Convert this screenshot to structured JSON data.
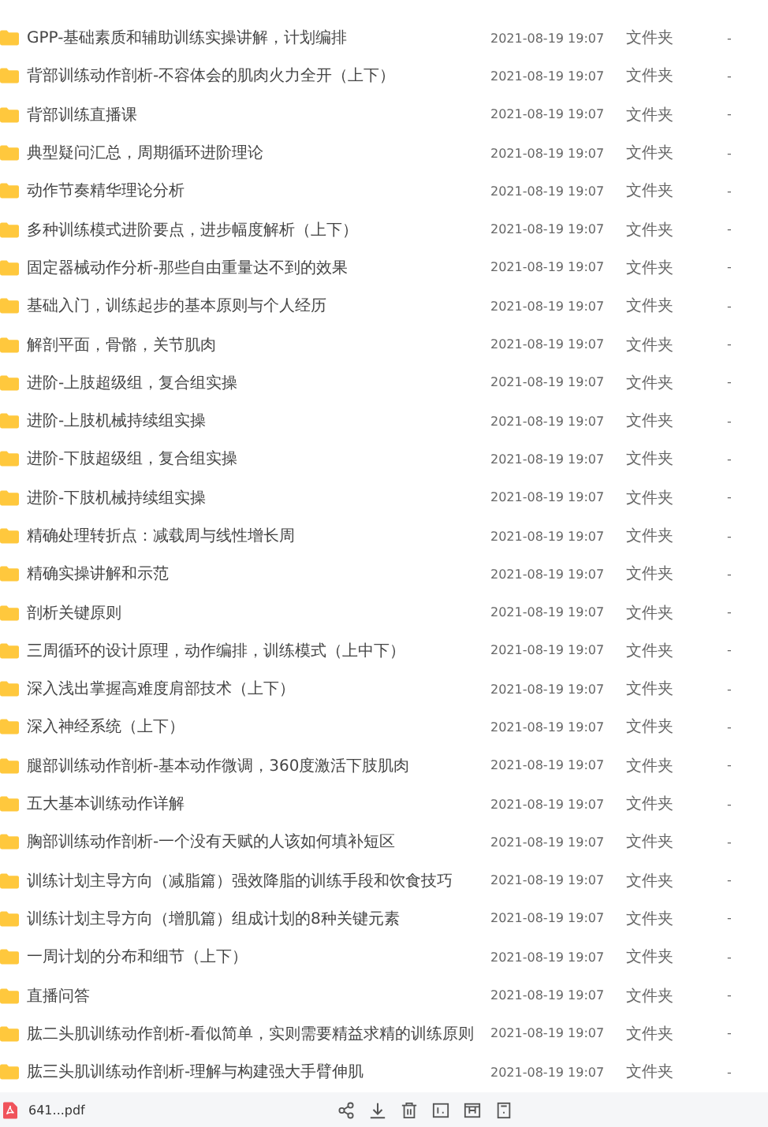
{
  "files": [
    {
      "name": "GPP-基础素质和辅助训练实操讲解，计划编排",
      "modified": "2021-08-19 19:07",
      "type": "文件夹",
      "size": "-"
    },
    {
      "name": "背部训练动作剖析-不容体会的肌肉火力全开（上下）",
      "modified": "2021-08-19 19:07",
      "type": "文件夹",
      "size": "-"
    },
    {
      "name": "背部训练直播课",
      "modified": "2021-08-19 19:07",
      "type": "文件夹",
      "size": "-"
    },
    {
      "name": "典型疑问汇总，周期循环进阶理论",
      "modified": "2021-08-19 19:07",
      "type": "文件夹",
      "size": "-"
    },
    {
      "name": "动作节奏精华理论分析",
      "modified": "2021-08-19 19:07",
      "type": "文件夹",
      "size": "-"
    },
    {
      "name": "多种训练模式进阶要点，进步幅度解析（上下）",
      "modified": "2021-08-19 19:07",
      "type": "文件夹",
      "size": "-"
    },
    {
      "name": "固定器械动作分析-那些自由重量达不到的效果",
      "modified": "2021-08-19 19:07",
      "type": "文件夹",
      "size": "-"
    },
    {
      "name": "基础入门，训练起步的基本原则与个人经历",
      "modified": "2021-08-19 19:07",
      "type": "文件夹",
      "size": "-"
    },
    {
      "name": "解剖平面，骨骼，关节肌肉",
      "modified": "2021-08-19 19:07",
      "type": "文件夹",
      "size": "-"
    },
    {
      "name": "进阶-上肢超级组，复合组实操",
      "modified": "2021-08-19 19:07",
      "type": "文件夹",
      "size": "-"
    },
    {
      "name": "进阶-上肢机械持续组实操",
      "modified": "2021-08-19 19:07",
      "type": "文件夹",
      "size": "-"
    },
    {
      "name": "进阶-下肢超级组，复合组实操",
      "modified": "2021-08-19 19:07",
      "type": "文件夹",
      "size": "-"
    },
    {
      "name": "进阶-下肢机械持续组实操",
      "modified": "2021-08-19 19:07",
      "type": "文件夹",
      "size": "-"
    },
    {
      "name": "精确处理转折点：减载周与线性增长周",
      "modified": "2021-08-19 19:07",
      "type": "文件夹",
      "size": "-"
    },
    {
      "name": "精确实操讲解和示范",
      "modified": "2021-08-19 19:07",
      "type": "文件夹",
      "size": "-"
    },
    {
      "name": "剖析关键原则",
      "modified": "2021-08-19 19:07",
      "type": "文件夹",
      "size": "-"
    },
    {
      "name": "三周循环的设计原理，动作编排，训练模式（上中下）",
      "modified": "2021-08-19 19:07",
      "type": "文件夹",
      "size": "-"
    },
    {
      "name": "深入浅出掌握高难度肩部技术（上下）",
      "modified": "2021-08-19 19:07",
      "type": "文件夹",
      "size": "-"
    },
    {
      "name": "深入神经系统（上下）",
      "modified": "2021-08-19 19:07",
      "type": "文件夹",
      "size": "-"
    },
    {
      "name": "腿部训练动作剖析-基本动作微调，360度激活下肢肌肉",
      "modified": "2021-08-19 19:07",
      "type": "文件夹",
      "size": "-"
    },
    {
      "name": "五大基本训练动作详解",
      "modified": "2021-08-19 19:07",
      "type": "文件夹",
      "size": "-"
    },
    {
      "name": "胸部训练动作剖析-一个没有天赋的人该如何填补短区",
      "modified": "2021-08-19 19:07",
      "type": "文件夹",
      "size": "-"
    },
    {
      "name": "训练计划主导方向（减脂篇）强效降脂的训练手段和饮食技巧",
      "modified": "2021-08-19 19:07",
      "type": "文件夹",
      "size": "-"
    },
    {
      "name": "训练计划主导方向（增肌篇）组成计划的8种关键元素",
      "modified": "2021-08-19 19:07",
      "type": "文件夹",
      "size": "-"
    },
    {
      "name": "一周计划的分布和细节（上下）",
      "modified": "2021-08-19 19:07",
      "type": "文件夹",
      "size": "-"
    },
    {
      "name": "直播问答",
      "modified": "2021-08-19 19:07",
      "type": "文件夹",
      "size": "-"
    },
    {
      "name": "肱二头肌训练动作剖析-看似简单，实则需要精益求精的训练原则",
      "modified": "2021-08-19 19:07",
      "type": "文件夹",
      "size": "-"
    },
    {
      "name": "肱三头肌训练动作剖析-理解与构建强大手臂伸肌",
      "modified": "2021-08-19 19:07",
      "type": "文件夹",
      "size": "-"
    }
  ],
  "download_bar": {
    "file_name": "641...pdf"
  }
}
